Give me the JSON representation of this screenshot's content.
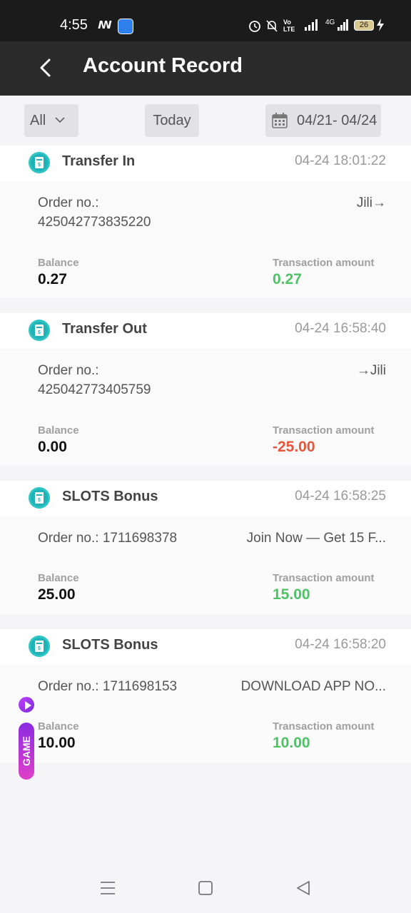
{
  "status_bar": {
    "time": "4:55",
    "lte_label": "Vo\nLTE",
    "net_label": "4G",
    "battery": "26"
  },
  "header": {
    "title": "Account Record",
    "back_icon": "chevron-left-icon"
  },
  "filters": {
    "type": "All",
    "today": "Today",
    "date_range": "04/21- 04/24"
  },
  "records": [
    {
      "type": "Transfer In",
      "time": "04-24 18:01:22",
      "order_label": "Order no.:",
      "order_no": "425042773835220",
      "note": "Jili→",
      "balance_label": "Balance",
      "balance": "0.27",
      "amount_label": "Transaction amount",
      "amount": "0.27",
      "amount_sign": "positive"
    },
    {
      "type": "Transfer Out",
      "time": "04-24 16:58:40",
      "order_label": "Order no.:",
      "order_no": "425042773405759",
      "note": "→Jili",
      "balance_label": "Balance",
      "balance": "0.00",
      "amount_label": "Transaction amount",
      "amount": "-25.00",
      "amount_sign": "negative"
    },
    {
      "type": "SLOTS Bonus",
      "time": "04-24 16:58:25",
      "order_label": "Order no.: 1711698378",
      "note": "Join Now — Get 15 F...",
      "balance_label": "Balance",
      "balance": "25.00",
      "amount_label": "Transaction amount",
      "amount": "15.00",
      "amount_sign": "positive"
    },
    {
      "type": "SLOTS Bonus",
      "time": "04-24 16:58:20",
      "order_label": "Order no.: 1711698153",
      "note": "DOWNLOAD APP NO...",
      "balance_label": "Balance",
      "balance": "10.00",
      "amount_label": "Transaction amount",
      "amount": "10.00",
      "amount_sign": "positive"
    }
  ],
  "floating": {
    "game_label": "GAME"
  },
  "colors": {
    "positive": "#4dc464",
    "negative": "#e8553a",
    "header_bg": "#2b2b2b",
    "icon_teal": "#2ec4c4"
  }
}
